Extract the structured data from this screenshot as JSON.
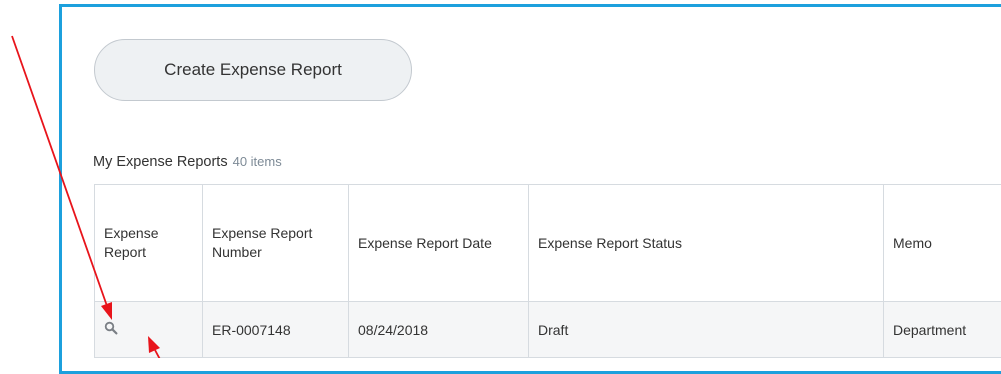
{
  "create_button": {
    "label": "Create Expense Report"
  },
  "section": {
    "title": "My Expense Reports",
    "count": "40 items"
  },
  "table": {
    "headers": [
      "Expense Report",
      "Expense Report Number",
      "Expense Report Date",
      "Expense Report Status",
      "Memo"
    ],
    "rows": [
      {
        "report_icon": "search-icon",
        "number": "ER-0007148",
        "date": "08/24/2018",
        "status": "Draft",
        "memo": "Department"
      }
    ]
  },
  "annotation": {
    "arrow_color": "#e8141b"
  },
  "colors": {
    "panel_border": "#1ca0dd",
    "button_bg": "#eef1f3"
  }
}
